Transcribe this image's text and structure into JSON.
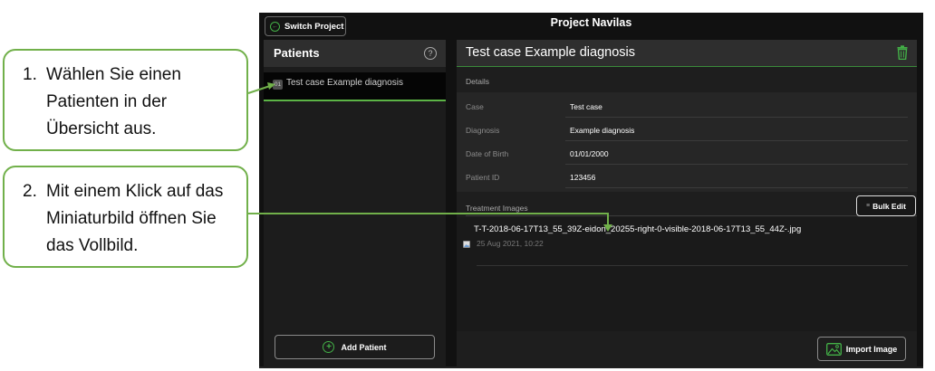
{
  "callouts": [
    {
      "number": "1.",
      "text": "Wählen Sie einen Patienten in der Übersicht aus."
    },
    {
      "number": "2.",
      "text": "Mit einem Klick auf das Miniaturbild öffnen Sie das Vollbild."
    }
  ],
  "app": {
    "switch_project_label": "Switch Project",
    "project_title": "Project Navilas"
  },
  "patients_panel": {
    "title": "Patients",
    "items": [
      {
        "index": "01",
        "name": "Test case Example diagnosis"
      }
    ],
    "add_patient_label": "Add Patient"
  },
  "patient_detail": {
    "title": "Test case Example diagnosis",
    "details_label": "Details",
    "fields": [
      {
        "key": "Case",
        "value": "Test case"
      },
      {
        "key": "Diagnosis",
        "value": "Example diagnosis"
      },
      {
        "key": "Date of Birth",
        "value": "01/01/2000"
      },
      {
        "key": "Patient ID",
        "value": "123456"
      }
    ],
    "treatment_images_label": "Treatment Images",
    "bulk_edit_label": "Bulk Edit",
    "images": [
      {
        "filename": "T-T-2018-06-17T13_55_39Z-eidon_20255-right-0-visible-2018-06-17T13_55_44Z-.jpg",
        "date": "25 Aug 2021, 10:22"
      }
    ],
    "import_image_label": "Import Image"
  },
  "colors": {
    "accent_green": "#43b047",
    "callout_border": "#71b04a"
  },
  "icons": [
    "switch-icon",
    "help-icon",
    "trash-icon",
    "add-icon",
    "bulk-edit-icon",
    "broken-image-icon",
    "import-image-icon"
  ]
}
